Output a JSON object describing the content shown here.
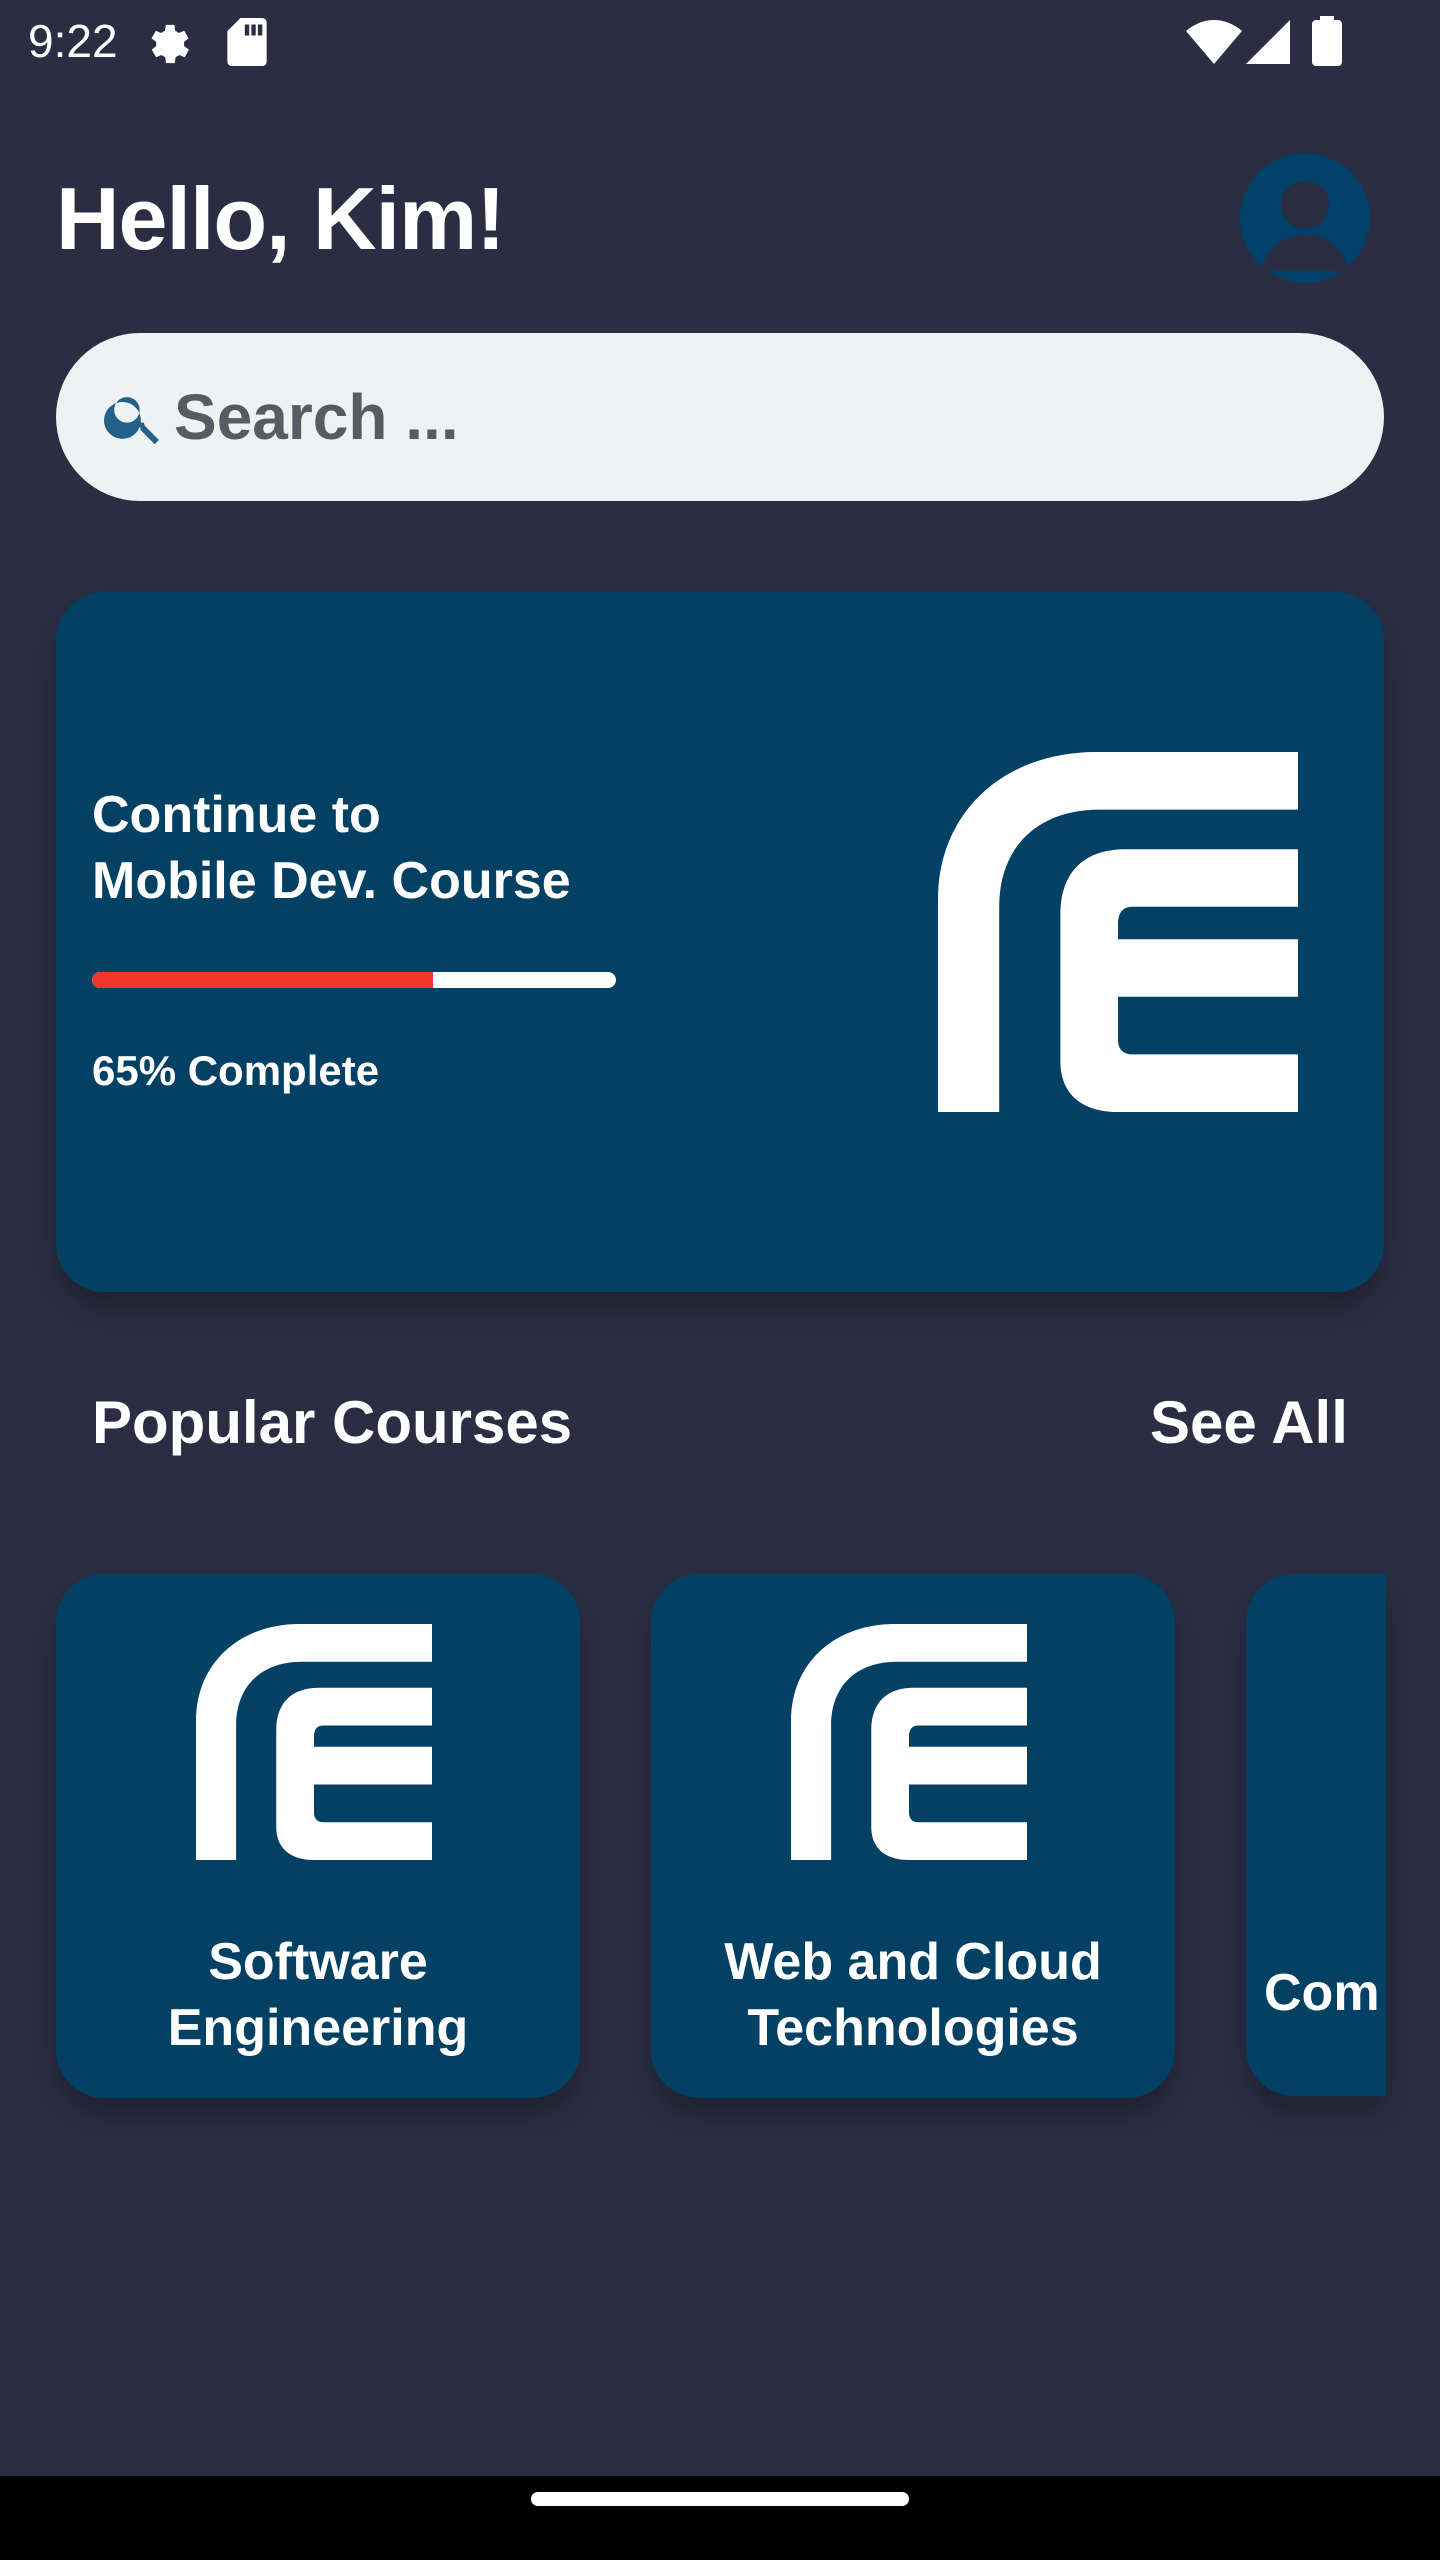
{
  "status_bar": {
    "time": "9:22",
    "icons": [
      "settings-gear-icon",
      "sd-card-icon",
      "wifi-icon",
      "cellular-signal-icon",
      "battery-icon"
    ]
  },
  "header": {
    "greeting": "Hello, Kim!",
    "avatar_icon": "user-avatar-icon"
  },
  "search": {
    "placeholder": "Search ...",
    "value": "",
    "icon": "search-icon"
  },
  "continue_card": {
    "title": "Continue to\nMobile Dev. Course",
    "progress": 0.65,
    "progress_label": "65% Complete",
    "logo": "course-logo-icon"
  },
  "popular": {
    "title": "Popular Courses",
    "see_all": "See All",
    "courses": [
      {
        "name": "Software\nEngineering"
      },
      {
        "name": "Web and Cloud\nTechnologies"
      },
      {
        "name": "Com"
      }
    ]
  },
  "colors": {
    "background": "#2b2d42",
    "card": "#024064",
    "progress_fill": "#f0352b",
    "progress_track": "#ffffff",
    "search_bg": "#eff1f3"
  }
}
